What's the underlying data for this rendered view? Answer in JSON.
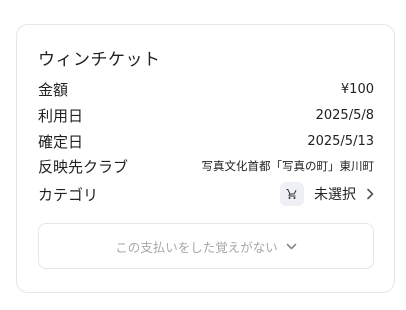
{
  "card": {
    "title": "ウィンチケット",
    "rows": [
      {
        "label": "金額",
        "value": "¥100"
      },
      {
        "label": "利用日",
        "value": "2025/5/8"
      },
      {
        "label": "確定日",
        "value": "2025/5/13"
      },
      {
        "label": "反映先クラブ",
        "value": "写真文化首都「写真の町」東川町"
      }
    ],
    "category": {
      "label": "カテゴリ",
      "icon": "shopping-cart-icon",
      "value": "未選択"
    },
    "unrecognized_button": {
      "label": "この支払いをした覚えがない"
    }
  }
}
